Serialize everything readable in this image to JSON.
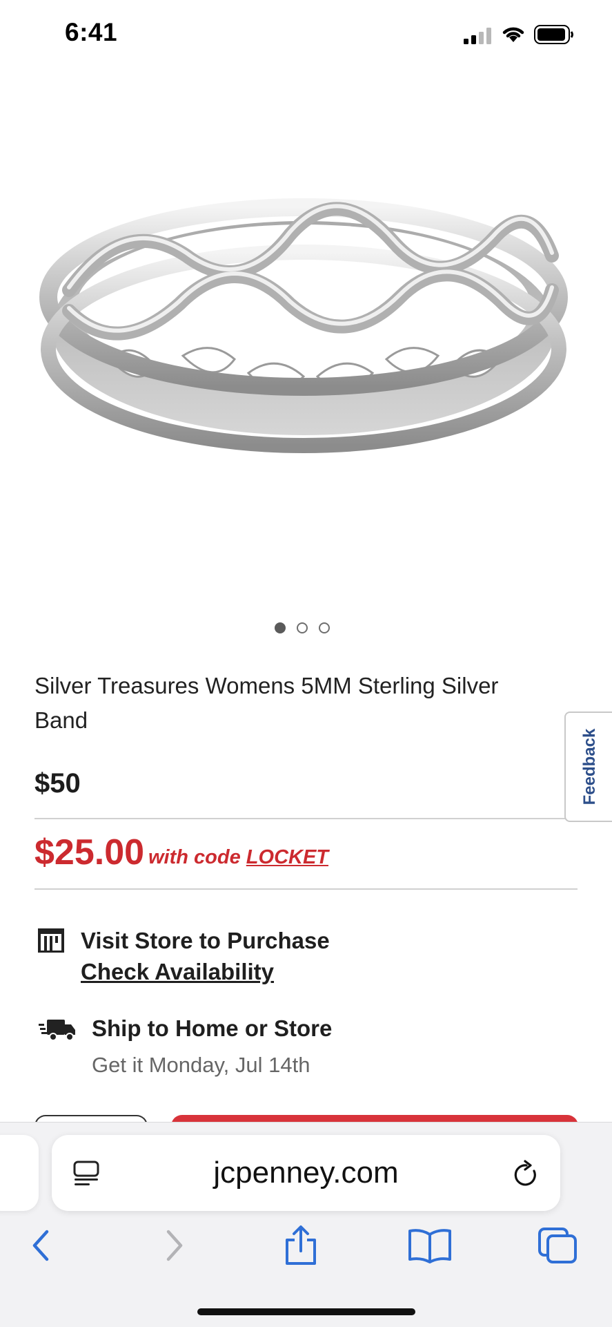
{
  "status_bar": {
    "time": "6:41"
  },
  "product": {
    "image_alt": "",
    "carousel": {
      "total": 3,
      "active": 1
    },
    "title": "Silver Treasures Womens 5MM Sterling Silver Band",
    "original_price": "$50",
    "sale_price": "$25.00",
    "promo_prefix": "with code",
    "promo_code": "LOCKET"
  },
  "fulfillment": {
    "store_title": "Visit Store to Purchase",
    "store_link": "Check Availability",
    "ship_title": "Ship to Home or Store",
    "ship_date": "Get it Monday, Jul 14th"
  },
  "feedback": {
    "label": "Feedback"
  },
  "browser": {
    "url": "jcpenney.com",
    "icons": {
      "reader": "reader-icon",
      "reload": "reload-icon",
      "back": "chevron-left-icon",
      "forward": "chevron-right-icon",
      "share": "share-icon",
      "bookmarks": "book-icon",
      "tabs": "tabs-icon"
    }
  },
  "colors": {
    "sale_red": "#cc2a2f",
    "link_blue": "#2f6fd6",
    "feedback_blue": "#2c4e8a"
  }
}
